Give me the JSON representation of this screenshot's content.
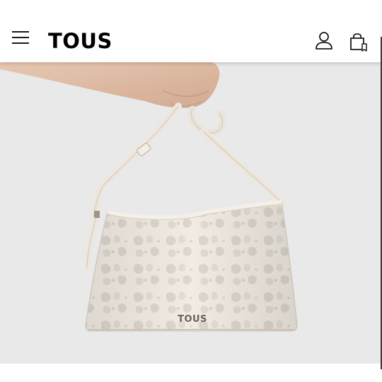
{
  "header": {
    "brand": "TOUS",
    "menu_icon": "hamburger-menu-icon",
    "account_icon": "user-account-icon",
    "bag_icon": "shopping-bag-icon"
  },
  "hero": {
    "bag_plate_text": "TOUS"
  },
  "colors": {
    "header_bg": "#ffffff",
    "hero_bg": "#e9e9ea",
    "bag_cream": "#f1ebe2",
    "pattern": "#dcd6cd"
  }
}
